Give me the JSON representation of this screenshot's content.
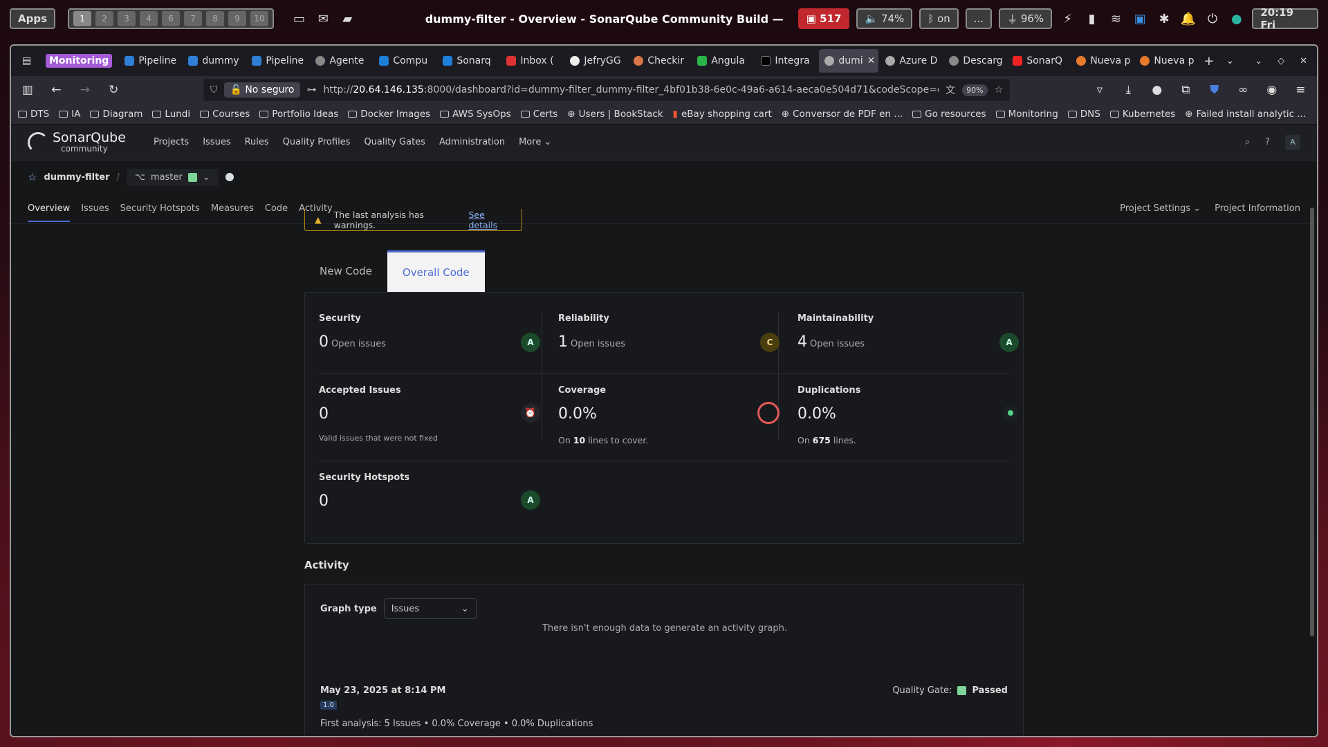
{
  "system": {
    "apps": "Apps",
    "workspaces": [
      "1",
      "2",
      "3",
      "4",
      "6",
      "7",
      "8",
      "9",
      "10"
    ],
    "window_title": "dummy-filter - Overview - SonarQube Community Build — Own — Mozilla ...",
    "updates": "517",
    "volume": "74%",
    "bluetooth": "on",
    "more": "...",
    "battery": "96%",
    "clock": "20:19 Fri"
  },
  "browser": {
    "tabs": [
      "Monitoring",
      "Pipeline",
      "dummy",
      "Pipeline",
      "Agente",
      "Compu",
      "Sonarq",
      "Inbox (",
      "JefryGG",
      "Checkir",
      "Angula",
      "Integra",
      "dumi",
      "Azure D",
      "Descarg",
      "SonarQ",
      "Nueva p",
      "Nueva p"
    ],
    "not_secure": "No seguro",
    "url_host": "20.64.146.135",
    "url_prefix": "http://",
    "url_rest": ":8000/dashboard?id=dummy-filter_dummy-filter_4bf01b38-6e0c-49a6-a614-aeca0e504d71&codeScope=overall",
    "zoom": "90%",
    "bookmarks": [
      "DTS",
      "IA",
      "Diagram",
      "Lundi",
      "Courses",
      "Portfolio Ideas",
      "Docker Images",
      "AWS SysOps",
      "Certs",
      "Users | BookStack",
      "eBay shopping cart",
      "Conversor de PDF en ...",
      "Go resources",
      "Monitoring",
      "DNS",
      "Kubernetes",
      "Failed install analytic ..."
    ]
  },
  "sonar": {
    "logo": "SonarQube",
    "logo_sub": "community",
    "nav": [
      "Projects",
      "Issues",
      "Rules",
      "Quality Profiles",
      "Quality Gates",
      "Administration",
      "More"
    ],
    "avatar": "A",
    "project": "dummy-filter",
    "branch": "master",
    "subnav": [
      "Overview",
      "Issues",
      "Security Hotspots",
      "Measures",
      "Code",
      "Activity"
    ],
    "project_settings": "Project Settings",
    "project_info": "Project Information",
    "warning": "The last analysis has warnings.",
    "warning_link": "See details",
    "tabs": [
      "New Code",
      "Overall Code"
    ],
    "metrics": {
      "security": {
        "title": "Security",
        "value": "0",
        "label": "Open issues",
        "rating": "A"
      },
      "reliability": {
        "title": "Reliability",
        "value": "1",
        "label": "Open issues",
        "rating": "C"
      },
      "maintainability": {
        "title": "Maintainability",
        "value": "4",
        "label": "Open issues",
        "rating": "A"
      },
      "accepted": {
        "title": "Accepted Issues",
        "value": "0",
        "sub": "Valid issues that were not fixed"
      },
      "coverage": {
        "title": "Coverage",
        "value": "0.0%",
        "sub_pre": "On",
        "sub_num": "10",
        "sub_post": "lines to cover."
      },
      "duplications": {
        "title": "Duplications",
        "value": "0.0%",
        "sub_pre": "On",
        "sub_num": "675",
        "sub_post": "lines."
      },
      "hotspots": {
        "title": "Security Hotspots",
        "value": "0",
        "rating": "A"
      }
    },
    "activity": {
      "title": "Activity",
      "graph_label": "Graph type",
      "graph_value": "Issues",
      "no_data": "There isn't enough data to generate an activity graph.",
      "date": "May 23, 2025 at 8:14 PM",
      "version": "1.0",
      "qg_label": "Quality Gate:",
      "qg_value": "Passed",
      "first": "First analysis:  5 Issues  •  0.0% Coverage  •  0.0% Duplications"
    }
  }
}
